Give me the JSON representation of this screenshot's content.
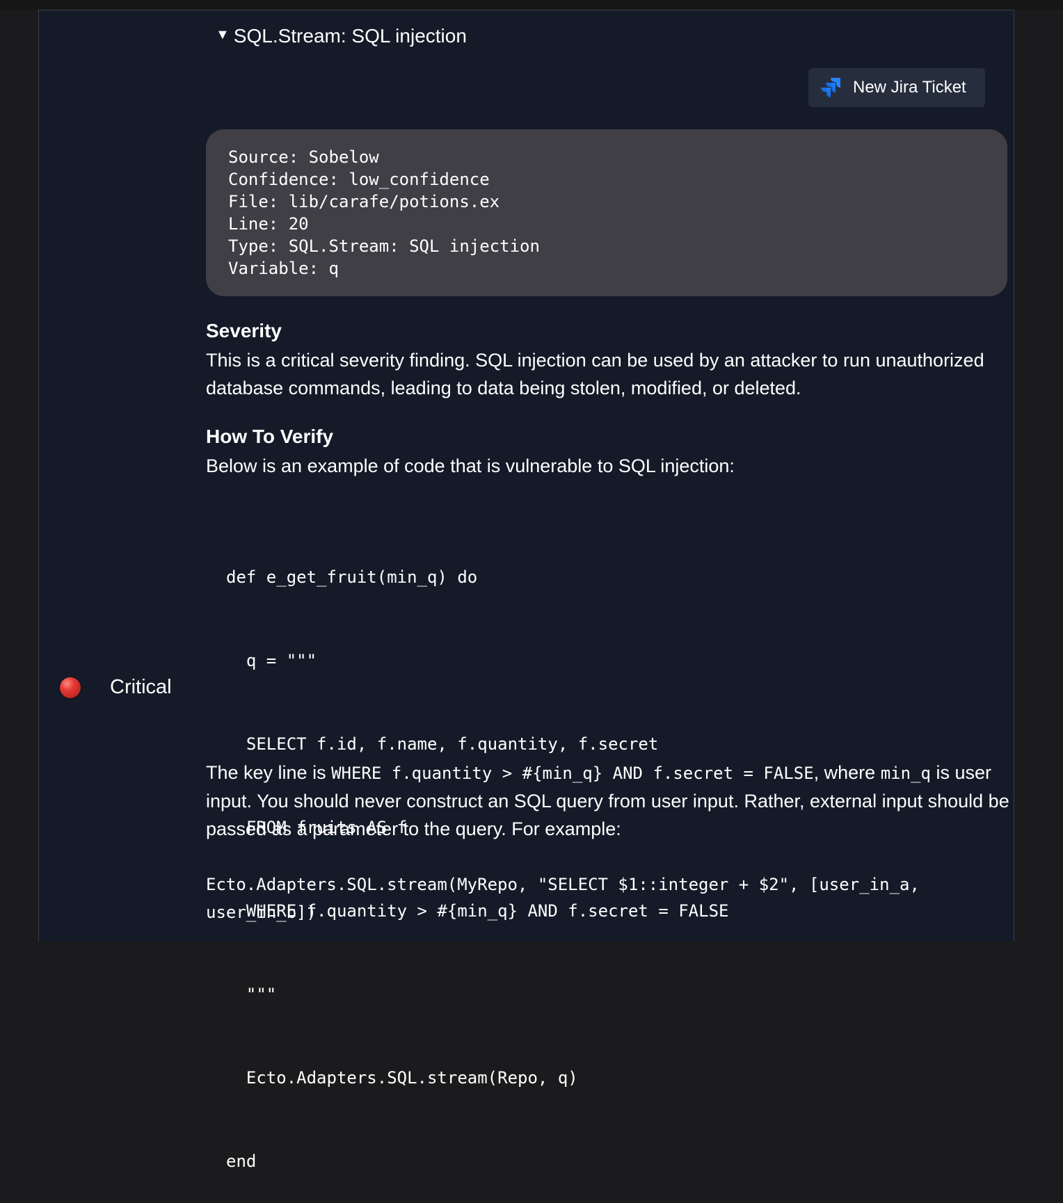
{
  "summary": {
    "caret": "▼",
    "title": "SQL.Stream: SQL injection"
  },
  "jira_button": {
    "label": "New Jira Ticket"
  },
  "severity": {
    "label": "Critical",
    "color": "#e53935"
  },
  "meta": {
    "lines": [
      "Source: Sobelow",
      "Confidence: low_confidence",
      "File: lib/carafe/potions.ex",
      "Line: 20",
      "Type: SQL.Stream: SQL injection",
      "Variable: q"
    ]
  },
  "sections": {
    "severity_heading": "Severity",
    "severity_text": "This is a critical severity finding. SQL injection can be used by an attacker to run unauthorized database commands, leading to data being stolen, modified, or deleted.",
    "verify_heading": "How To Verify",
    "verify_text": "Below is an example of code that is vulnerable to SQL injection:"
  },
  "code": {
    "lines": [
      "def e_get_fruit(min_q) do",
      "  q = \"\"\"",
      "  SELECT f.id, f.name, f.quantity, f.secret",
      "  FROM fruits AS f",
      "  WHERE f.quantity > #{min_q} AND f.secret = FALSE",
      "  \"\"\"",
      "  Ecto.Adapters.SQL.stream(Repo, q)",
      "end"
    ]
  },
  "explanation": {
    "prefix": "The key line is ",
    "key_line": "WHERE f.quantity > #{min_q} AND f.secret = FALSE",
    "middle": ", where ",
    "variable": "min_q",
    "suffix": " is user input. You should never construct an SQL query from user input. Rather, external input should be passed as a parameter to the query. For example:"
  },
  "example": "Ecto.Adapters.SQL.stream(MyRepo, \"SELECT $1::integer + $2\", [user_in_a, user_in_b])"
}
